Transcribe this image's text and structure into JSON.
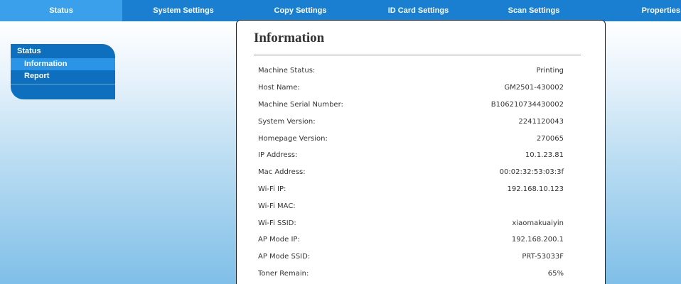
{
  "nav": {
    "tabs": [
      "Status",
      "System Settings",
      "Copy Settings",
      "ID Card Settings",
      "Scan Settings",
      "Properties"
    ],
    "active": "Status"
  },
  "sidebar": {
    "title": "Status",
    "items": [
      "Information",
      "Report"
    ],
    "active": "Information"
  },
  "main": {
    "title": "Information",
    "rows": [
      {
        "label": "Machine Status:",
        "value": "Printing"
      },
      {
        "label": "Host Name:",
        "value": "GM2501-430002"
      },
      {
        "label": "Machine Serial Number:",
        "value": "B106210734430002"
      },
      {
        "label": "System Version:",
        "value": "2241120043"
      },
      {
        "label": "Homepage Version:",
        "value": "270065"
      },
      {
        "label": "IP Address:",
        "value": "10.1.23.81"
      },
      {
        "label": "Mac Address:",
        "value": "00:02:32:53:03:3f"
      },
      {
        "label": "Wi-Fi IP:",
        "value": "192.168.10.123"
      },
      {
        "label": "Wi-Fi MAC:",
        "value": ""
      },
      {
        "label": "Wi-Fi SSID:",
        "value": "xiaomakuaiyin"
      },
      {
        "label": "AP Mode IP:",
        "value": "192.168.200.1"
      },
      {
        "label": "AP Mode SSID:",
        "value": "PRT-53033F"
      },
      {
        "label": "Toner Remain:",
        "value": "65%"
      }
    ]
  },
  "colors": {
    "nav_bar": "#1b7fd1",
    "nav_active": "#3aa0ec",
    "sidebar_bg": "#0f6fbf",
    "sidebar_active": "#2b94e6",
    "background_bottom": "#7fbfe8"
  }
}
